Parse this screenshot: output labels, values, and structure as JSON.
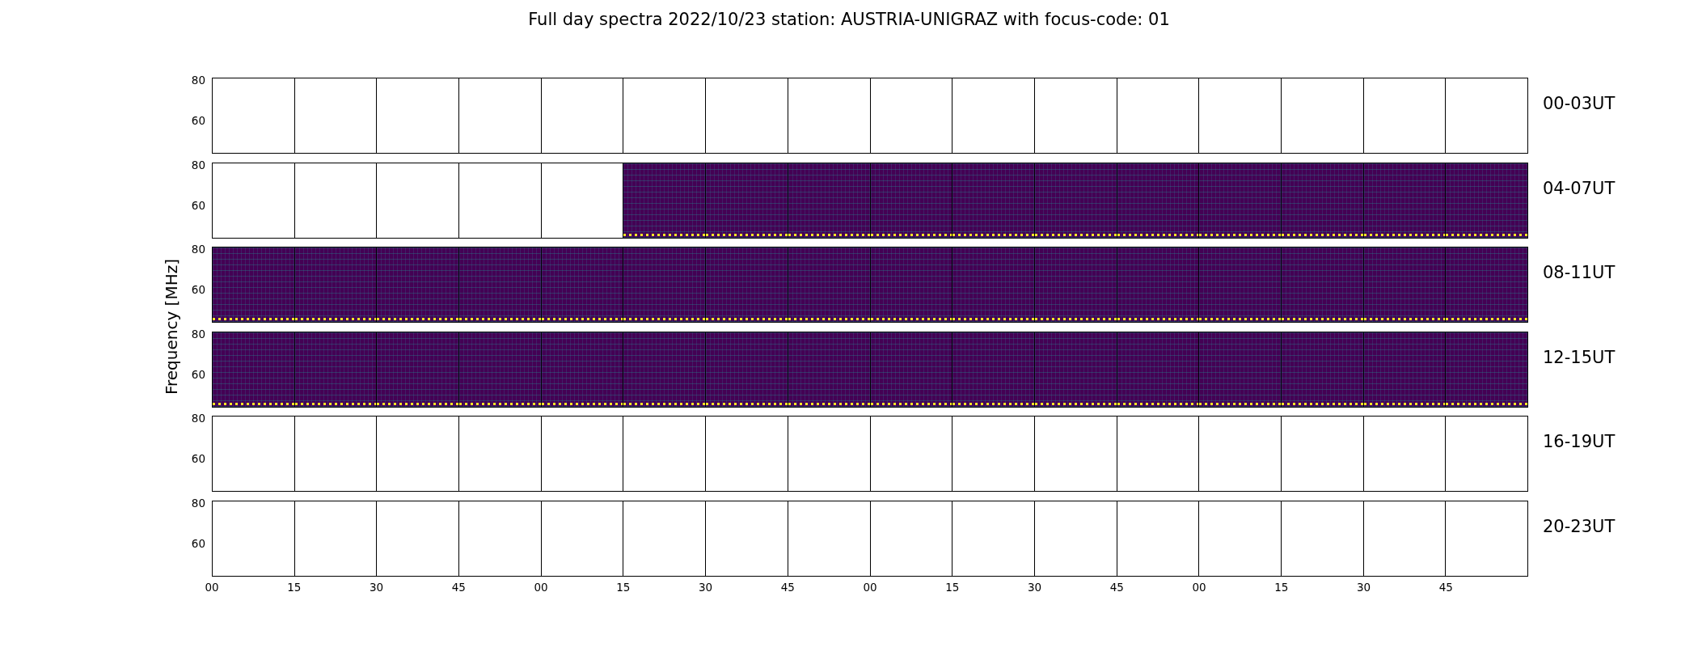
{
  "title": "Full day spectra 2022/10/23 station: AUSTRIA-UNIGRAZ with focus-code: 01",
  "ylabel": "Frequency [MHz]",
  "xticks": [
    "00",
    "15",
    "30",
    "45",
    "00",
    "15",
    "30",
    "45",
    "00",
    "15",
    "30",
    "45",
    "00",
    "15",
    "30",
    "45"
  ],
  "rows": [
    {
      "label": "00-03UT",
      "yticks": [
        "80",
        "60"
      ],
      "panels": [
        {
          "kind": "empty"
        },
        {
          "kind": "empty"
        },
        {
          "kind": "empty"
        },
        {
          "kind": "empty"
        },
        {
          "kind": "empty"
        },
        {
          "kind": "empty"
        },
        {
          "kind": "empty"
        },
        {
          "kind": "empty"
        },
        {
          "kind": "empty"
        },
        {
          "kind": "empty"
        },
        {
          "kind": "empty"
        },
        {
          "kind": "empty"
        },
        {
          "kind": "empty"
        },
        {
          "kind": "empty"
        },
        {
          "kind": "empty"
        },
        {
          "kind": "empty"
        }
      ]
    },
    {
      "label": "04-07UT",
      "yticks": [
        "80",
        "60"
      ],
      "panels": [
        {
          "kind": "empty"
        },
        {
          "kind": "empty"
        },
        {
          "kind": "empty"
        },
        {
          "kind": "empty"
        },
        {
          "kind": "empty"
        },
        {
          "kind": "spectrogram"
        },
        {
          "kind": "spectrogram"
        },
        {
          "kind": "spectrogram"
        },
        {
          "kind": "spectrogram"
        },
        {
          "kind": "spectrogram"
        },
        {
          "kind": "spectrogram"
        },
        {
          "kind": "spectrogram"
        },
        {
          "kind": "spectrogram"
        },
        {
          "kind": "spectrogram"
        },
        {
          "kind": "spectrogram"
        },
        {
          "kind": "spectrogram"
        }
      ]
    },
    {
      "label": "08-11UT",
      "yticks": [
        "80",
        "60"
      ],
      "panels": [
        {
          "kind": "spectrogram"
        },
        {
          "kind": "spectrogram"
        },
        {
          "kind": "spectrogram"
        },
        {
          "kind": "spectrogram"
        },
        {
          "kind": "spectrogram"
        },
        {
          "kind": "spectrogram"
        },
        {
          "kind": "spectrogram"
        },
        {
          "kind": "spectrogram"
        },
        {
          "kind": "spectrogram"
        },
        {
          "kind": "spectrogram"
        },
        {
          "kind": "spectrogram"
        },
        {
          "kind": "spectrogram"
        },
        {
          "kind": "spectrogram"
        },
        {
          "kind": "spectrogram"
        },
        {
          "kind": "spectrogram"
        },
        {
          "kind": "spectrogram"
        }
      ]
    },
    {
      "label": "12-15UT",
      "yticks": [
        "80",
        "60"
      ],
      "panels": [
        {
          "kind": "spectrogram"
        },
        {
          "kind": "spectrogram"
        },
        {
          "kind": "spectrogram"
        },
        {
          "kind": "spectrogram"
        },
        {
          "kind": "spectrogram"
        },
        {
          "kind": "spectrogram"
        },
        {
          "kind": "spectrogram"
        },
        {
          "kind": "spectrogram"
        },
        {
          "kind": "spectrogram"
        },
        {
          "kind": "spectrogram"
        },
        {
          "kind": "spectrogram"
        },
        {
          "kind": "spectrogram"
        },
        {
          "kind": "spectrogram"
        },
        {
          "kind": "spectrogram"
        },
        {
          "kind": "spectrogram"
        },
        {
          "kind": "spectrogram"
        }
      ]
    },
    {
      "label": "16-19UT",
      "yticks": [
        "80",
        "60"
      ],
      "panels": [
        {
          "kind": "empty"
        },
        {
          "kind": "empty"
        },
        {
          "kind": "empty"
        },
        {
          "kind": "empty"
        },
        {
          "kind": "empty"
        },
        {
          "kind": "empty"
        },
        {
          "kind": "empty"
        },
        {
          "kind": "empty"
        },
        {
          "kind": "empty"
        },
        {
          "kind": "empty"
        },
        {
          "kind": "empty"
        },
        {
          "kind": "empty"
        },
        {
          "kind": "empty"
        },
        {
          "kind": "empty"
        },
        {
          "kind": "empty"
        },
        {
          "kind": "empty"
        }
      ]
    },
    {
      "label": "20-23UT",
      "yticks": [
        "80",
        "60"
      ],
      "panels": [
        {
          "kind": "empty"
        },
        {
          "kind": "empty"
        },
        {
          "kind": "empty"
        },
        {
          "kind": "empty"
        },
        {
          "kind": "empty"
        },
        {
          "kind": "empty"
        },
        {
          "kind": "empty"
        },
        {
          "kind": "empty"
        },
        {
          "kind": "empty"
        },
        {
          "kind": "empty"
        },
        {
          "kind": "empty"
        },
        {
          "kind": "empty"
        },
        {
          "kind": "empty"
        },
        {
          "kind": "empty"
        },
        {
          "kind": "empty"
        },
        {
          "kind": "empty"
        }
      ]
    }
  ]
}
